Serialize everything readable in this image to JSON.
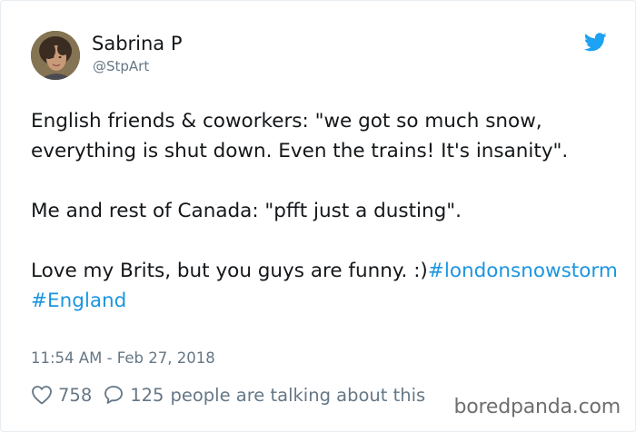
{
  "author": {
    "display_name": "Sabrina P",
    "handle": "@StpArt"
  },
  "brand": {
    "icon": "twitter-bird-icon",
    "color": "#1da1f2"
  },
  "tweet": {
    "line1_text": "English friends & coworkers: \"we got so much snow, everything is shut down. Even the trains! It's insanity\".",
    "line2_text": "Me and rest of Canada: \"pfft just a dusting\".",
    "line3_text": "Love my Brits, but you guys are funny. :)",
    "hashtag1": "#londonsnowstorm",
    "hashtag2": "#England",
    "hashtag_color": "#1b95e0"
  },
  "timestamp": "11:54 AM - Feb 27, 2018",
  "actions": {
    "like_icon": "heart-icon",
    "like_count": "758",
    "reply_icon": "speech-bubble-icon",
    "reply_count": "125",
    "talking_text": "people are talking about this"
  },
  "watermark": "boredpanda.com"
}
